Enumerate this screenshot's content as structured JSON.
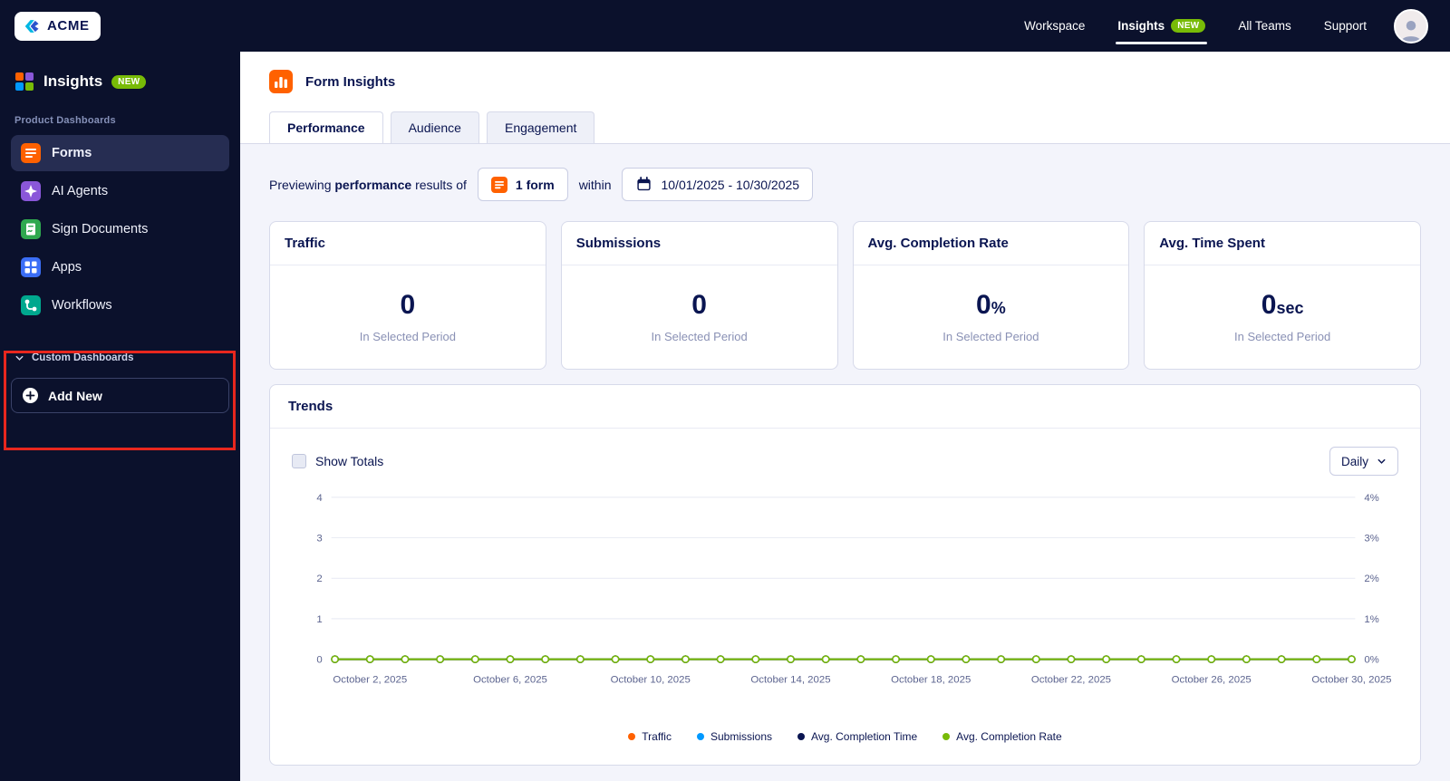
{
  "brand": {
    "logo_text": "ACME"
  },
  "top_nav": {
    "items": [
      {
        "label": "Workspace",
        "active": false
      },
      {
        "label": "Insights",
        "badge": "NEW",
        "active": true
      },
      {
        "label": "All Teams",
        "active": false
      },
      {
        "label": "Support",
        "active": false
      }
    ]
  },
  "sidebar": {
    "title": "Insights",
    "title_badge": "NEW",
    "section_product": "Product Dashboards",
    "items": [
      {
        "label": "Forms",
        "icon": "forms-icon",
        "active": true
      },
      {
        "label": "AI Agents",
        "icon": "ai-agents-icon",
        "active": false
      },
      {
        "label": "Sign Documents",
        "icon": "sign-documents-icon",
        "active": false
      },
      {
        "label": "Apps",
        "icon": "apps-icon",
        "active": false
      },
      {
        "label": "Workflows",
        "icon": "workflows-icon",
        "active": false
      }
    ],
    "section_custom": "Custom Dashboards",
    "add_new_label": "Add New"
  },
  "main": {
    "page_title": "Form Insights",
    "tabs": [
      {
        "label": "Performance",
        "active": true
      },
      {
        "label": "Audience",
        "active": false
      },
      {
        "label": "Engagement",
        "active": false
      }
    ],
    "filter": {
      "prefix": "Previewing",
      "bold": "performance",
      "suffix": "results of",
      "form_chip": "1 form",
      "within": "within",
      "date_range": "10/01/2025 - 10/30/2025"
    },
    "stat_cards": [
      {
        "title": "Traffic",
        "value": "0",
        "unit": "",
        "caption": "In Selected Period"
      },
      {
        "title": "Submissions",
        "value": "0",
        "unit": "",
        "caption": "In Selected Period"
      },
      {
        "title": "Avg. Completion Rate",
        "value": "0",
        "unit": "%",
        "caption": "In Selected Period"
      },
      {
        "title": "Avg. Time Spent",
        "value": "0",
        "unit": "sec",
        "caption": "In Selected Period"
      }
    ],
    "trends": {
      "title": "Trends",
      "show_totals_label": "Show Totals",
      "show_totals_checked": false,
      "interval_label": "Daily"
    }
  },
  "chart_data": {
    "type": "line",
    "x_unit": "day",
    "n_points": 30,
    "x_tick_indices": [
      1,
      5,
      9,
      13,
      17,
      21,
      25,
      29
    ],
    "x_tick_labels": [
      "October 2, 2025",
      "October 6, 2025",
      "October 10, 2025",
      "October 14, 2025",
      "October 18, 2025",
      "October 22, 2025",
      "October 26, 2025",
      "October 30, 2025"
    ],
    "left_axis": {
      "min": 0,
      "max": 4,
      "ticks": [
        0,
        1,
        2,
        3,
        4
      ]
    },
    "right_axis": {
      "ticks": [
        "0%",
        "1%",
        "2%",
        "3%",
        "4%"
      ]
    },
    "grid": true,
    "legend_position": "bottom",
    "series": [
      {
        "name": "Traffic",
        "color": "#ff6100",
        "values": [
          0,
          0,
          0,
          0,
          0,
          0,
          0,
          0,
          0,
          0,
          0,
          0,
          0,
          0,
          0,
          0,
          0,
          0,
          0,
          0,
          0,
          0,
          0,
          0,
          0,
          0,
          0,
          0,
          0,
          0
        ]
      },
      {
        "name": "Submissions",
        "color": "#0099ff",
        "values": [
          0,
          0,
          0,
          0,
          0,
          0,
          0,
          0,
          0,
          0,
          0,
          0,
          0,
          0,
          0,
          0,
          0,
          0,
          0,
          0,
          0,
          0,
          0,
          0,
          0,
          0,
          0,
          0,
          0,
          0
        ]
      },
      {
        "name": "Avg. Completion Time",
        "color": "#0a1551",
        "values": [
          0,
          0,
          0,
          0,
          0,
          0,
          0,
          0,
          0,
          0,
          0,
          0,
          0,
          0,
          0,
          0,
          0,
          0,
          0,
          0,
          0,
          0,
          0,
          0,
          0,
          0,
          0,
          0,
          0,
          0
        ]
      },
      {
        "name": "Avg. Completion Rate",
        "color": "#78bb07",
        "values": [
          0,
          0,
          0,
          0,
          0,
          0,
          0,
          0,
          0,
          0,
          0,
          0,
          0,
          0,
          0,
          0,
          0,
          0,
          0,
          0,
          0,
          0,
          0,
          0,
          0,
          0,
          0,
          0,
          0,
          0
        ]
      }
    ]
  },
  "annotations": [
    {
      "type": "rectangle",
      "target": "custom-dashboards-section",
      "color": "#e8271e"
    }
  ],
  "colors": {
    "header_bg": "#0b112c",
    "navy": "#0a1551",
    "orange": "#ff6100",
    "green": "#78bb07",
    "blue": "#0099ff",
    "content_bg": "#f3f4fb"
  }
}
